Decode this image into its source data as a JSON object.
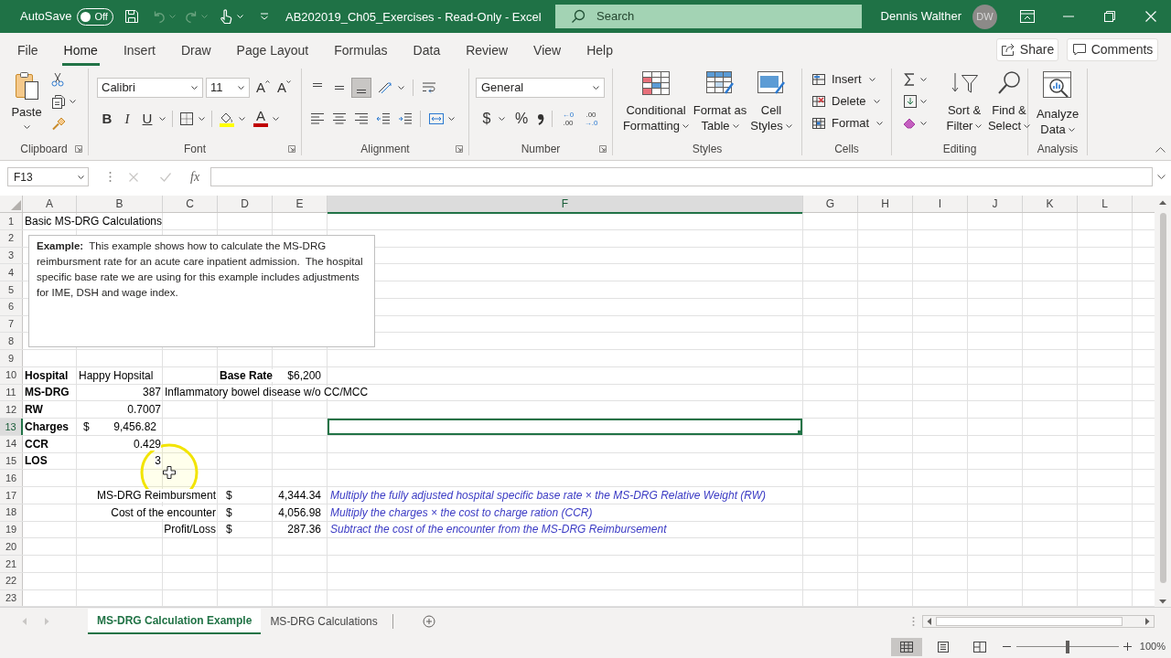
{
  "title_bar": {
    "autosave": {
      "label": "AutoSave",
      "state_label": "Off",
      "on": false
    },
    "quick_access": [
      {
        "kind": "save",
        "disabled": false
      },
      {
        "kind": "undo",
        "disabled": true
      },
      {
        "kind": "redo",
        "disabled": true
      },
      {
        "kind": "touch",
        "disabled": false
      }
    ],
    "title": "AB202019_Ch05_Exercises - Read-Only - Excel",
    "search": {
      "placeholder": "Search"
    },
    "user": {
      "name": "Dennis Walther",
      "initials": "DW"
    }
  },
  "ribbon_tabs": [
    {
      "label": "File",
      "selected": false
    },
    {
      "label": "Home",
      "selected": true
    },
    {
      "label": "Insert",
      "selected": false
    },
    {
      "label": "Draw",
      "selected": false
    },
    {
      "label": "Page Layout",
      "selected": false
    },
    {
      "label": "Formulas",
      "selected": false
    },
    {
      "label": "Data",
      "selected": false
    },
    {
      "label": "Review",
      "selected": false
    },
    {
      "label": "View",
      "selected": false
    },
    {
      "label": "Help",
      "selected": false
    }
  ],
  "ribbon_actions": [
    {
      "kind": "share",
      "label": "Share"
    },
    {
      "kind": "comments",
      "label": "Comments"
    }
  ],
  "ribbon": {
    "clipboard": {
      "label": "Clipboard",
      "paste": "Paste"
    },
    "font": {
      "label": "Font",
      "font_name": "Calibri",
      "font_size": "11",
      "size_buttons": [
        {
          "kind": "grow",
          "label": "A"
        },
        {
          "kind": "shrink",
          "label": "A"
        }
      ],
      "styles": [
        {
          "kind": "bold",
          "label": "B"
        },
        {
          "kind": "italic",
          "label": "I"
        },
        {
          "kind": "underline",
          "label": "U"
        }
      ],
      "font_color": "A"
    },
    "alignment": {
      "label": "Alignment",
      "vertical": [
        {
          "kind": "top",
          "selected": false
        },
        {
          "kind": "middle",
          "selected": false
        },
        {
          "kind": "bottom",
          "selected": true
        }
      ]
    },
    "number": {
      "label": "Number",
      "format": "General",
      "currency": "$",
      "percent": "%",
      "decimals": [
        {
          "kind": "increase",
          "lines": [
            "←0",
            ".00"
          ]
        },
        {
          "kind": "decrease",
          "lines": [
            ".00",
            "→.0"
          ]
        }
      ]
    },
    "styles": {
      "label": "Styles",
      "buttons": [
        {
          "kind": "conditional",
          "lines": [
            "Conditional",
            "Formatting"
          ]
        },
        {
          "kind": "table",
          "lines": [
            "Format as",
            "Table"
          ]
        },
        {
          "kind": "cell_styles",
          "lines": [
            "Cell",
            "Styles"
          ]
        }
      ]
    },
    "cells": {
      "label": "Cells",
      "buttons": [
        {
          "kind": "insert",
          "label": "Insert"
        },
        {
          "kind": "delete",
          "label": "Delete"
        },
        {
          "kind": "format",
          "label": "Format"
        }
      ]
    },
    "editing": {
      "label": "Editing",
      "buttons": [
        {
          "kind": "sort",
          "lines": [
            "Sort &",
            "Filter"
          ]
        },
        {
          "kind": "find",
          "lines": [
            "Find &",
            "Select"
          ]
        }
      ]
    },
    "analysis": {
      "label": "Analysis",
      "buttons": [
        {
          "kind": "analyze",
          "lines": [
            "Analyze",
            "Data"
          ]
        }
      ]
    }
  },
  "formula_bar": {
    "name_box": "F13",
    "function_label": "fx"
  },
  "sheet": {
    "columns": [
      {
        "label": "A",
        "selected": false
      },
      {
        "label": "B",
        "selected": false
      },
      {
        "label": "C",
        "selected": false
      },
      {
        "label": "D",
        "selected": false
      },
      {
        "label": "E",
        "selected": false
      },
      {
        "label": "F",
        "selected": true
      },
      {
        "label": "G",
        "selected": false
      },
      {
        "label": "H",
        "selected": false
      },
      {
        "label": "I",
        "selected": false
      },
      {
        "label": "J",
        "selected": false
      },
      {
        "label": "K",
        "selected": false
      },
      {
        "label": "L",
        "selected": false
      }
    ],
    "rows": [
      {
        "label": "1",
        "selected": false,
        "cells": [
          {
            "kind": "text",
            "value": "Basic MS-DRG Calculations"
          }
        ]
      },
      {
        "label": "2",
        "selected": false
      },
      {
        "label": "3",
        "selected": false
      },
      {
        "label": "4",
        "selected": false
      },
      {
        "label": "5",
        "selected": false
      },
      {
        "label": "6",
        "selected": false
      },
      {
        "label": "7",
        "selected": false
      },
      {
        "label": "8",
        "selected": false
      },
      {
        "label": "9",
        "selected": false
      },
      {
        "label": "10",
        "selected": false,
        "cells": [
          {
            "kind": "label",
            "value": "Hospital"
          },
          {
            "kind": "text",
            "value": "Happy Hopsital"
          },
          {
            "kind": "empty"
          },
          {
            "kind": "label",
            "value": "Base Rate"
          },
          {
            "kind": "currency",
            "value": "$6,200"
          }
        ]
      },
      {
        "label": "11",
        "selected": false,
        "cells": [
          {
            "kind": "label",
            "value": "MS-DRG"
          },
          {
            "kind": "number",
            "value": "387"
          },
          {
            "kind": "text",
            "value": "Inflammatory bowel disease w/o CC/MCC"
          }
        ]
      },
      {
        "label": "12",
        "selected": false,
        "cells": [
          {
            "kind": "label",
            "value": "RW"
          },
          {
            "kind": "number",
            "value": "0.7007"
          }
        ]
      },
      {
        "label": "13",
        "selected": true,
        "cells": [
          {
            "kind": "label",
            "value": "Charges"
          },
          {
            "kind": "accounting",
            "symbol": "$",
            "value": "9,456.82"
          }
        ]
      },
      {
        "label": "14",
        "selected": false,
        "cells": [
          {
            "kind": "label",
            "value": "CCR"
          },
          {
            "kind": "number",
            "value": "0.429"
          }
        ]
      },
      {
        "label": "15",
        "selected": false,
        "cells": [
          {
            "kind": "label",
            "value": "LOS"
          },
          {
            "kind": "number",
            "value": "3"
          }
        ]
      },
      {
        "label": "16",
        "selected": false
      },
      {
        "label": "17",
        "selected": false,
        "cells": [
          {
            "kind": "empty"
          },
          {
            "kind": "empty"
          },
          {
            "kind": "caption",
            "value": "MS-DRG Reimbursment"
          },
          {
            "kind": "symbol",
            "value": "$"
          },
          {
            "kind": "currency",
            "value": "4,344.34"
          },
          {
            "kind": "note",
            "value": "Multiply the fully adjusted hospital specific base rate × the MS-DRG Relative Weight (RW)"
          }
        ]
      },
      {
        "label": "18",
        "selected": false,
        "cells": [
          {
            "kind": "empty"
          },
          {
            "kind": "empty"
          },
          {
            "kind": "caption",
            "value": "Cost of the encounter"
          },
          {
            "kind": "symbol",
            "value": "$"
          },
          {
            "kind": "currency",
            "value": "4,056.98"
          },
          {
            "kind": "note",
            "value": "Multiply the charges × the cost to charge ration (CCR)"
          }
        ]
      },
      {
        "label": "19",
        "selected": false,
        "cells": [
          {
            "kind": "empty"
          },
          {
            "kind": "empty"
          },
          {
            "kind": "caption",
            "value": "Profit/Loss"
          },
          {
            "kind": "symbol",
            "value": "$"
          },
          {
            "kind": "currency",
            "value": "287.36"
          },
          {
            "kind": "note",
            "value": "Subtract the cost of the encounter from the MS-DRG Reimbursement"
          }
        ]
      },
      {
        "label": "20",
        "selected": false
      },
      {
        "label": "21",
        "selected": false
      },
      {
        "label": "22",
        "selected": false
      },
      {
        "label": "23",
        "selected": false
      }
    ],
    "text_box": {
      "text": "**Example:**  This example shows how to calculate the MS-DRG reimbursment rate for an acute care inpatient admission.  The hospital specific base rate we are using for this example includes adjustments for IME, DSH and wage index."
    }
  },
  "sheet_tabs": [
    {
      "label": "MS-DRG Calculation Example",
      "selected": true
    },
    {
      "label": "MS-DRG Calculations",
      "selected": false
    }
  ],
  "status_bar": {
    "views": [
      {
        "kind": "normal",
        "selected": true
      },
      {
        "kind": "page_layout",
        "selected": false
      },
      {
        "kind": "page_break",
        "selected": false
      }
    ],
    "zoom": {
      "label": "100%",
      "level": 0.5
    }
  }
}
